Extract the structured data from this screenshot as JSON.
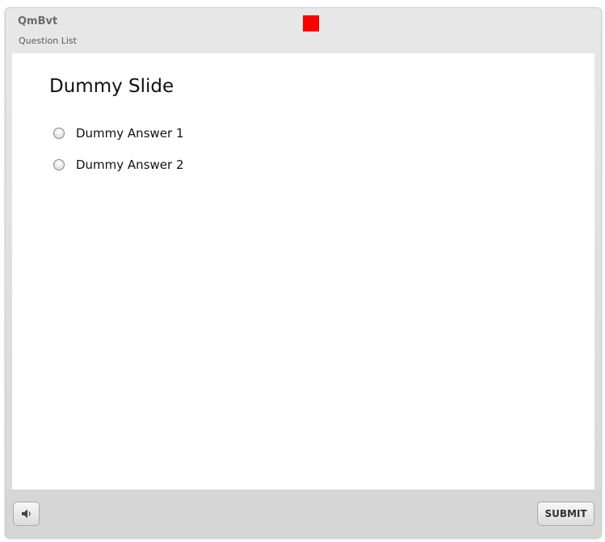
{
  "player": {
    "title": "QmBvt",
    "subtitle": "Question List",
    "marker_color": "#ff0000"
  },
  "slide": {
    "title": "Dummy Slide",
    "answers": [
      {
        "label": "Dummy Answer 1",
        "selected": false
      },
      {
        "label": "Dummy Answer 2",
        "selected": false
      }
    ]
  },
  "toolbar": {
    "audio_icon": "speaker-icon",
    "submit_label": "SUBMIT"
  }
}
